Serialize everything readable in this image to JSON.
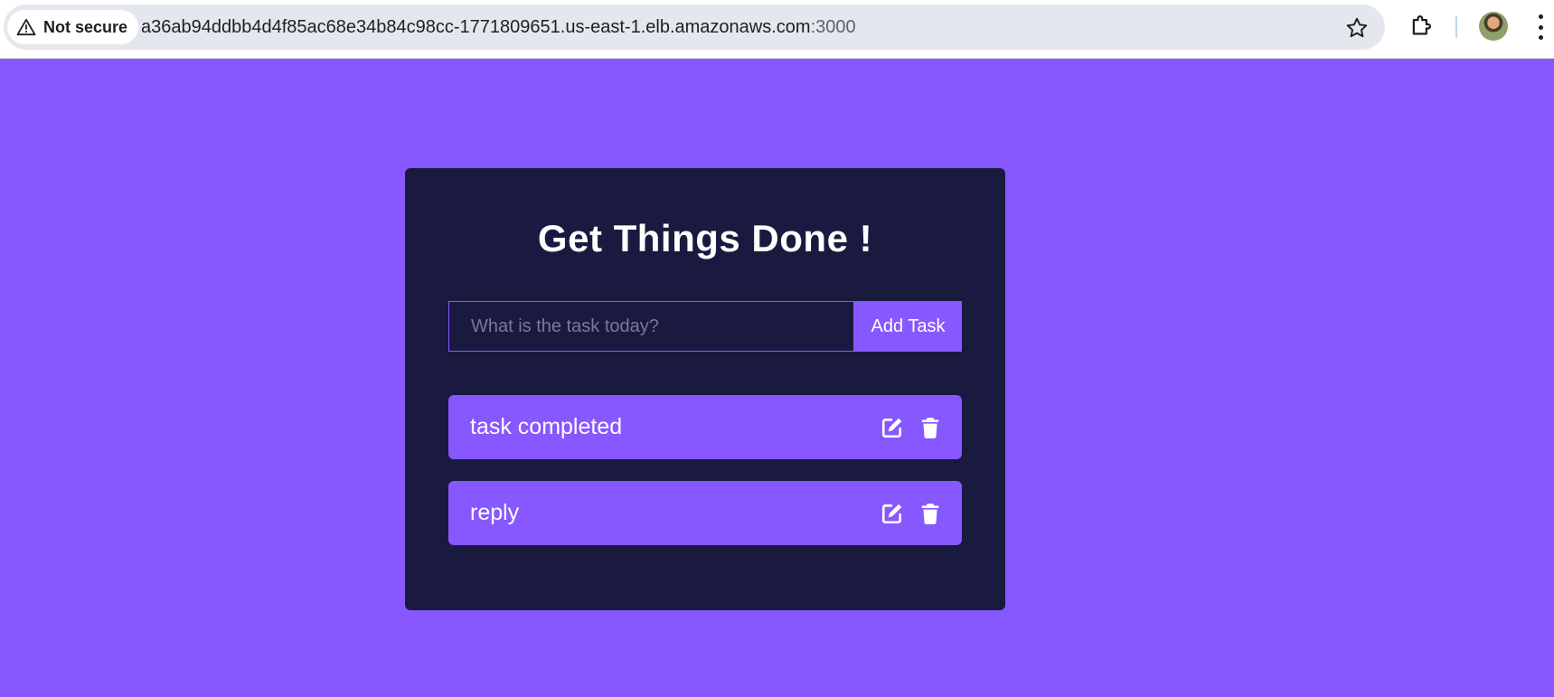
{
  "browser": {
    "security_label": "Not secure",
    "url_host": "a36ab94ddbb4d4f85ac68e34b84c98cc-1771809651.us-east-1.elb.amazonaws.com",
    "url_port": ":3000"
  },
  "app": {
    "title": "Get Things Done !",
    "input_placeholder": "What is the task today?",
    "input_value": "",
    "add_button_label": "Add Task",
    "todos": [
      {
        "text": "task completed",
        "edit_icon": "edit-icon",
        "delete_icon": "trash-icon"
      },
      {
        "text": "reply",
        "edit_icon": "edit-icon",
        "delete_icon": "trash-icon"
      }
    ]
  },
  "colors": {
    "page_background": "#8758ff",
    "card_background": "#1a1a40",
    "accent": "#8758ff",
    "text": "#ffffff"
  }
}
